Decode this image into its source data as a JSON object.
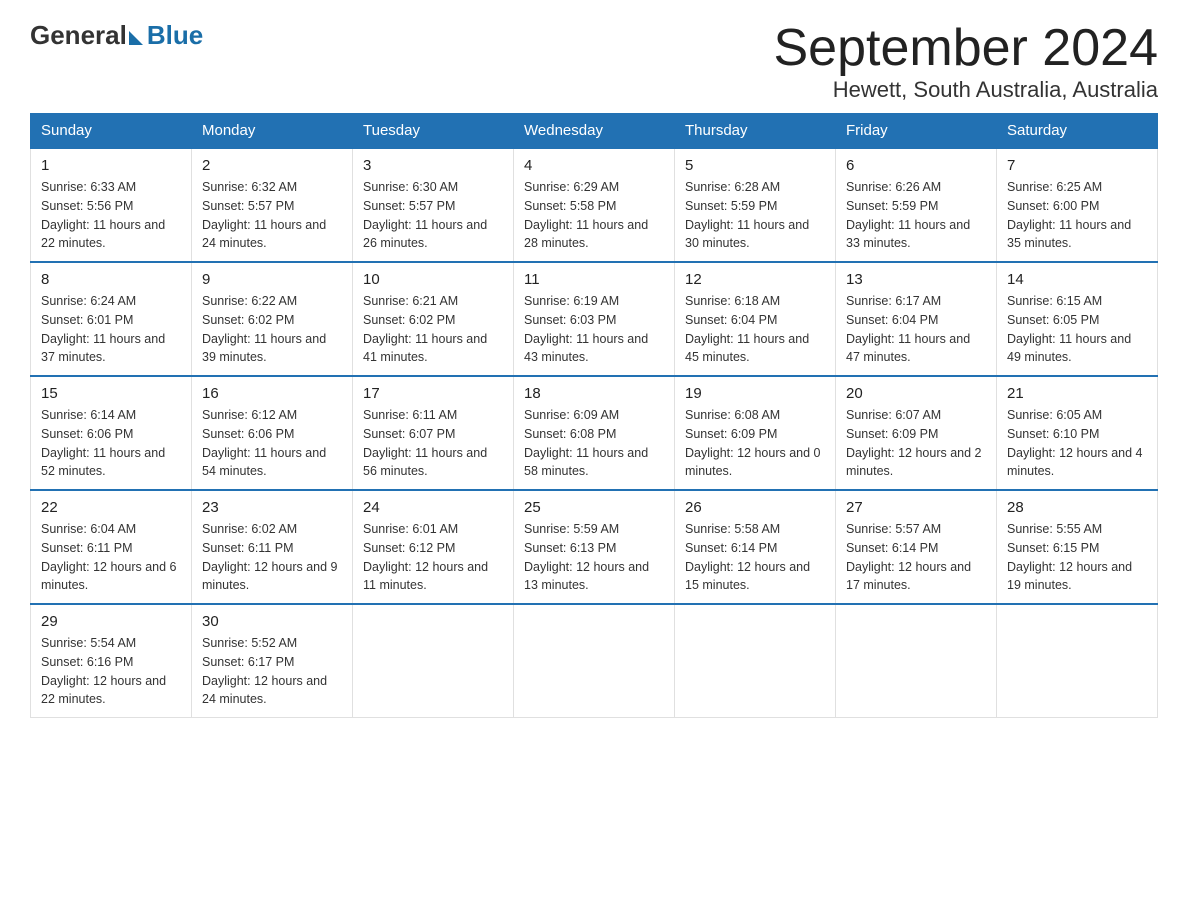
{
  "header": {
    "logo_general": "General",
    "logo_blue": "Blue",
    "month_title": "September 2024",
    "location": "Hewett, South Australia, Australia"
  },
  "days_of_week": [
    "Sunday",
    "Monday",
    "Tuesday",
    "Wednesday",
    "Thursday",
    "Friday",
    "Saturday"
  ],
  "weeks": [
    [
      {
        "day": "1",
        "sunrise": "Sunrise: 6:33 AM",
        "sunset": "Sunset: 5:56 PM",
        "daylight": "Daylight: 11 hours and 22 minutes."
      },
      {
        "day": "2",
        "sunrise": "Sunrise: 6:32 AM",
        "sunset": "Sunset: 5:57 PM",
        "daylight": "Daylight: 11 hours and 24 minutes."
      },
      {
        "day": "3",
        "sunrise": "Sunrise: 6:30 AM",
        "sunset": "Sunset: 5:57 PM",
        "daylight": "Daylight: 11 hours and 26 minutes."
      },
      {
        "day": "4",
        "sunrise": "Sunrise: 6:29 AM",
        "sunset": "Sunset: 5:58 PM",
        "daylight": "Daylight: 11 hours and 28 minutes."
      },
      {
        "day": "5",
        "sunrise": "Sunrise: 6:28 AM",
        "sunset": "Sunset: 5:59 PM",
        "daylight": "Daylight: 11 hours and 30 minutes."
      },
      {
        "day": "6",
        "sunrise": "Sunrise: 6:26 AM",
        "sunset": "Sunset: 5:59 PM",
        "daylight": "Daylight: 11 hours and 33 minutes."
      },
      {
        "day": "7",
        "sunrise": "Sunrise: 6:25 AM",
        "sunset": "Sunset: 6:00 PM",
        "daylight": "Daylight: 11 hours and 35 minutes."
      }
    ],
    [
      {
        "day": "8",
        "sunrise": "Sunrise: 6:24 AM",
        "sunset": "Sunset: 6:01 PM",
        "daylight": "Daylight: 11 hours and 37 minutes."
      },
      {
        "day": "9",
        "sunrise": "Sunrise: 6:22 AM",
        "sunset": "Sunset: 6:02 PM",
        "daylight": "Daylight: 11 hours and 39 minutes."
      },
      {
        "day": "10",
        "sunrise": "Sunrise: 6:21 AM",
        "sunset": "Sunset: 6:02 PM",
        "daylight": "Daylight: 11 hours and 41 minutes."
      },
      {
        "day": "11",
        "sunrise": "Sunrise: 6:19 AM",
        "sunset": "Sunset: 6:03 PM",
        "daylight": "Daylight: 11 hours and 43 minutes."
      },
      {
        "day": "12",
        "sunrise": "Sunrise: 6:18 AM",
        "sunset": "Sunset: 6:04 PM",
        "daylight": "Daylight: 11 hours and 45 minutes."
      },
      {
        "day": "13",
        "sunrise": "Sunrise: 6:17 AM",
        "sunset": "Sunset: 6:04 PM",
        "daylight": "Daylight: 11 hours and 47 minutes."
      },
      {
        "day": "14",
        "sunrise": "Sunrise: 6:15 AM",
        "sunset": "Sunset: 6:05 PM",
        "daylight": "Daylight: 11 hours and 49 minutes."
      }
    ],
    [
      {
        "day": "15",
        "sunrise": "Sunrise: 6:14 AM",
        "sunset": "Sunset: 6:06 PM",
        "daylight": "Daylight: 11 hours and 52 minutes."
      },
      {
        "day": "16",
        "sunrise": "Sunrise: 6:12 AM",
        "sunset": "Sunset: 6:06 PM",
        "daylight": "Daylight: 11 hours and 54 minutes."
      },
      {
        "day": "17",
        "sunrise": "Sunrise: 6:11 AM",
        "sunset": "Sunset: 6:07 PM",
        "daylight": "Daylight: 11 hours and 56 minutes."
      },
      {
        "day": "18",
        "sunrise": "Sunrise: 6:09 AM",
        "sunset": "Sunset: 6:08 PM",
        "daylight": "Daylight: 11 hours and 58 minutes."
      },
      {
        "day": "19",
        "sunrise": "Sunrise: 6:08 AM",
        "sunset": "Sunset: 6:09 PM",
        "daylight": "Daylight: 12 hours and 0 minutes."
      },
      {
        "day": "20",
        "sunrise": "Sunrise: 6:07 AM",
        "sunset": "Sunset: 6:09 PM",
        "daylight": "Daylight: 12 hours and 2 minutes."
      },
      {
        "day": "21",
        "sunrise": "Sunrise: 6:05 AM",
        "sunset": "Sunset: 6:10 PM",
        "daylight": "Daylight: 12 hours and 4 minutes."
      }
    ],
    [
      {
        "day": "22",
        "sunrise": "Sunrise: 6:04 AM",
        "sunset": "Sunset: 6:11 PM",
        "daylight": "Daylight: 12 hours and 6 minutes."
      },
      {
        "day": "23",
        "sunrise": "Sunrise: 6:02 AM",
        "sunset": "Sunset: 6:11 PM",
        "daylight": "Daylight: 12 hours and 9 minutes."
      },
      {
        "day": "24",
        "sunrise": "Sunrise: 6:01 AM",
        "sunset": "Sunset: 6:12 PM",
        "daylight": "Daylight: 12 hours and 11 minutes."
      },
      {
        "day": "25",
        "sunrise": "Sunrise: 5:59 AM",
        "sunset": "Sunset: 6:13 PM",
        "daylight": "Daylight: 12 hours and 13 minutes."
      },
      {
        "day": "26",
        "sunrise": "Sunrise: 5:58 AM",
        "sunset": "Sunset: 6:14 PM",
        "daylight": "Daylight: 12 hours and 15 minutes."
      },
      {
        "day": "27",
        "sunrise": "Sunrise: 5:57 AM",
        "sunset": "Sunset: 6:14 PM",
        "daylight": "Daylight: 12 hours and 17 minutes."
      },
      {
        "day": "28",
        "sunrise": "Sunrise: 5:55 AM",
        "sunset": "Sunset: 6:15 PM",
        "daylight": "Daylight: 12 hours and 19 minutes."
      }
    ],
    [
      {
        "day": "29",
        "sunrise": "Sunrise: 5:54 AM",
        "sunset": "Sunset: 6:16 PM",
        "daylight": "Daylight: 12 hours and 22 minutes."
      },
      {
        "day": "30",
        "sunrise": "Sunrise: 5:52 AM",
        "sunset": "Sunset: 6:17 PM",
        "daylight": "Daylight: 12 hours and 24 minutes."
      },
      null,
      null,
      null,
      null,
      null
    ]
  ]
}
